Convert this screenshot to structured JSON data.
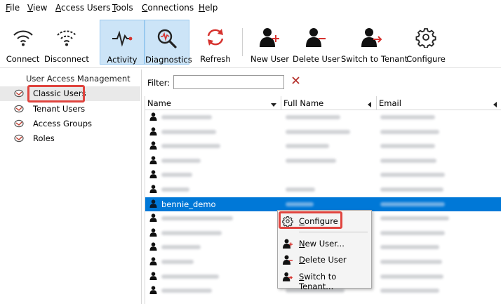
{
  "menubar": {
    "items": [
      "File",
      "View",
      "Access Users",
      "Tools",
      "Connections",
      "Help"
    ]
  },
  "toolbar": {
    "buttons": [
      {
        "label": "Connect",
        "icon": "wifi-icon"
      },
      {
        "label": "Disconnect",
        "icon": "wifi-off-icon"
      },
      {
        "label": "Activity",
        "icon": "pulse-icon",
        "active": true
      },
      {
        "label": "Diagnostics",
        "icon": "magnifier-icon",
        "active": true
      },
      {
        "label": "Refresh",
        "icon": "refresh-icon"
      },
      {
        "label": "New User",
        "icon": "user-add-icon"
      },
      {
        "label": "Delete User",
        "icon": "user-delete-icon"
      },
      {
        "label": "Switch to Tenant",
        "icon": "user-switch-icon"
      },
      {
        "label": "Configure",
        "icon": "gear-icon"
      }
    ]
  },
  "left_panel": {
    "title": "User Access Management",
    "items": [
      {
        "label": "Classic Users",
        "selected": true,
        "highlighted": true
      },
      {
        "label": "Tenant Users"
      },
      {
        "label": "Access Groups"
      },
      {
        "label": "Roles"
      }
    ]
  },
  "filter": {
    "label": "Filter:",
    "value": "",
    "clear_icon": "x-icon"
  },
  "table": {
    "columns": [
      "Name",
      "Full Name",
      "Email"
    ],
    "selected_row_name": "bennie_demo"
  },
  "context_menu": {
    "items": [
      {
        "label": "Configure",
        "icon": "gear-icon",
        "highlighted": true
      },
      {
        "label": "New User...",
        "icon": "user-add-icon"
      },
      {
        "label": "Delete User",
        "icon": "user-delete-icon"
      },
      {
        "label": "Switch to Tenant...",
        "icon": "user-switch-icon"
      }
    ]
  },
  "colors": {
    "selection": "#0078d7",
    "highlight_box": "#e0443e",
    "toolbar_active": "#cce4f7"
  }
}
